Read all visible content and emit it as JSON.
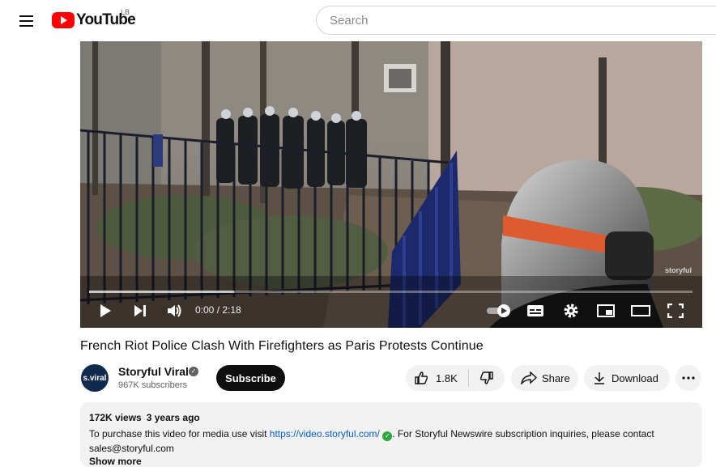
{
  "header": {
    "logo_text": "YouTube",
    "country_code": "LB",
    "search_placeholder": "Search"
  },
  "player": {
    "current_time": "0:00",
    "duration": "2:18",
    "time_display": "0:00 / 2:18",
    "progress_fraction": 0,
    "watermark": "storyful"
  },
  "video": {
    "title": "French Riot Police Clash With Firefighters as Paris Protests Continue"
  },
  "channel": {
    "avatar_text": "s.viral",
    "name": "Storyful Viral",
    "subscribers": "967K subscribers",
    "subscribe_label": "Subscribe"
  },
  "actions": {
    "like_count": "1.8K",
    "share_label": "Share",
    "download_label": "Download"
  },
  "description": {
    "views": "172K views",
    "age": "3 years ago",
    "text_before_link": "To purchase this video for media use visit ",
    "link": "https://video.storyful.com/",
    "text_after_link": ". For Storyful Newswire subscription inquiries, please contact sales@storyful.com",
    "show_more": "Show more"
  },
  "colors": {
    "brand_red": "#ff0000",
    "link_blue": "#065fd4",
    "verified_green": "#2ba640"
  }
}
